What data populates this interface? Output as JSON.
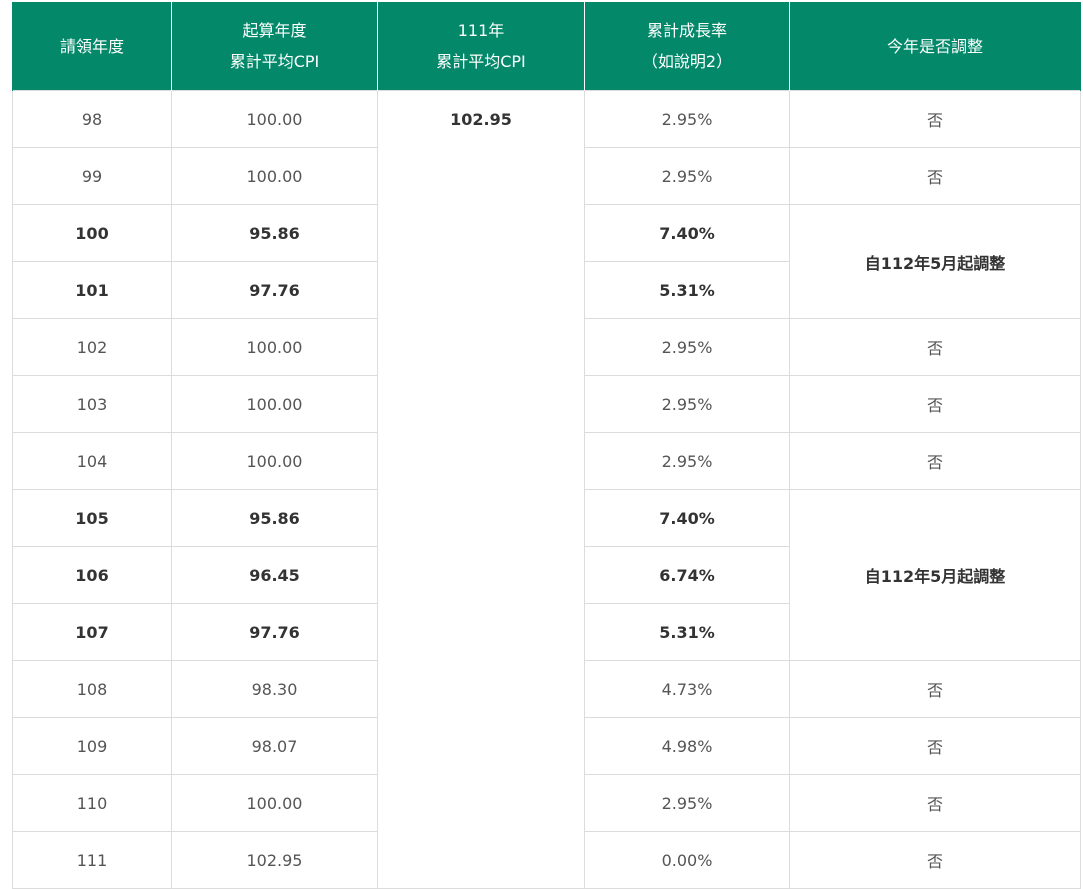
{
  "headers": [
    {
      "line1": "請領年度",
      "line2": ""
    },
    {
      "line1": "起算年度",
      "line2": "累計平均CPI"
    },
    {
      "line1": "111年",
      "line2": "累計平均CPI"
    },
    {
      "line1": "累計成長率",
      "line2": "（如說明2）"
    },
    {
      "line1": "今年是否調整",
      "line2": ""
    }
  ],
  "cpi_111": "102.95",
  "rows": [
    {
      "year": "98",
      "base_cpi": "100.00",
      "growth": "2.95%",
      "adjust": "否"
    },
    {
      "year": "99",
      "base_cpi": "100.00",
      "growth": "2.95%",
      "adjust": "否"
    },
    {
      "year": "100",
      "base_cpi": "95.86",
      "growth": "7.40%",
      "adjust": "自112年5月起調整"
    },
    {
      "year": "101",
      "base_cpi": "97.76",
      "growth": "5.31%",
      "adjust": ""
    },
    {
      "year": "102",
      "base_cpi": "100.00",
      "growth": "2.95%",
      "adjust": "否"
    },
    {
      "year": "103",
      "base_cpi": "100.00",
      "growth": "2.95%",
      "adjust": "否"
    },
    {
      "year": "104",
      "base_cpi": "100.00",
      "growth": "2.95%",
      "adjust": "否"
    },
    {
      "year": "105",
      "base_cpi": "95.86",
      "growth": "7.40%",
      "adjust": "自112年5月起調整"
    },
    {
      "year": "106",
      "base_cpi": "96.45",
      "growth": "6.74%",
      "adjust": ""
    },
    {
      "year": "107",
      "base_cpi": "97.76",
      "growth": "5.31%",
      "adjust": ""
    },
    {
      "year": "108",
      "base_cpi": "98.30",
      "growth": "4.73%",
      "adjust": "否"
    },
    {
      "year": "109",
      "base_cpi": "98.07",
      "growth": "4.98%",
      "adjust": "否"
    },
    {
      "year": "110",
      "base_cpi": "100.00",
      "growth": "2.95%",
      "adjust": "否"
    },
    {
      "year": "111",
      "base_cpi": "102.95",
      "growth": "0.00%",
      "adjust": "否"
    }
  ]
}
